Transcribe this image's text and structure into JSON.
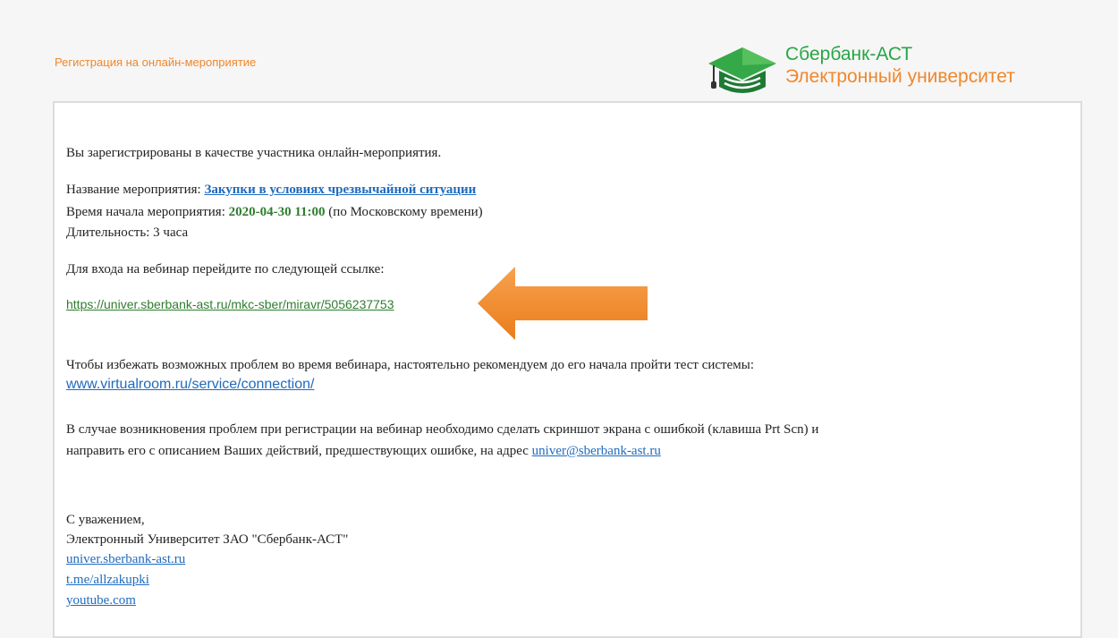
{
  "header": {
    "label": "Регистрация на онлайн-мероприятие",
    "logo_line1": "Сбербанк-АСТ",
    "logo_line2": "Электронный университет"
  },
  "email": {
    "intro": "Вы зарегистрированы в качестве участника онлайн-мероприятия.",
    "event_name_label": "Название мероприятия: ",
    "event_name": "Закупки в условиях чрезвычайной ситуации",
    "start_label": "Время начала мероприятия: ",
    "start_value": "2020-04-30 11:00",
    "start_suffix": " (по Московскому времени)",
    "duration": "Длительность: 3 часа",
    "webinar_prompt": "Для входа на вебинар перейдите по следующей ссылке:",
    "webinar_link": "https://univer.sberbank-ast.ru/mkc-sber/miravr/5056237753",
    "test_prompt": "Чтобы избежать возможных проблем во время вебинара, настоятельно рекомендуем до его начала пройти тест системы:",
    "test_link": "www.virtualroom.ru/service/connection/",
    "problem_text_1": "В случае возникновения проблем при регистрации на вебинар необходимо сделать скриншот экрана с ошибкой (клавиша Prt Scn) и",
    "problem_text_2": "направить его с описанием Ваших действий, предшествующих ошибке, на адрес ",
    "support_email": "univer@sberbank-ast.ru",
    "regards": "С уважением,",
    "signature": "Электронный Университет ЗАО \"Сбербанк-АСТ\"",
    "links": [
      "univer.sberbank-ast.ru",
      "t.me/allzakupki",
      "youtube.com"
    ]
  },
  "colors": {
    "accent_orange": "#f0872c",
    "brand_green": "#29a646",
    "link_blue": "#1f6bbf",
    "link_green": "#2f7d2f"
  },
  "icons": [
    "graduation-cap-logo-icon",
    "arrow-left-icon"
  ]
}
